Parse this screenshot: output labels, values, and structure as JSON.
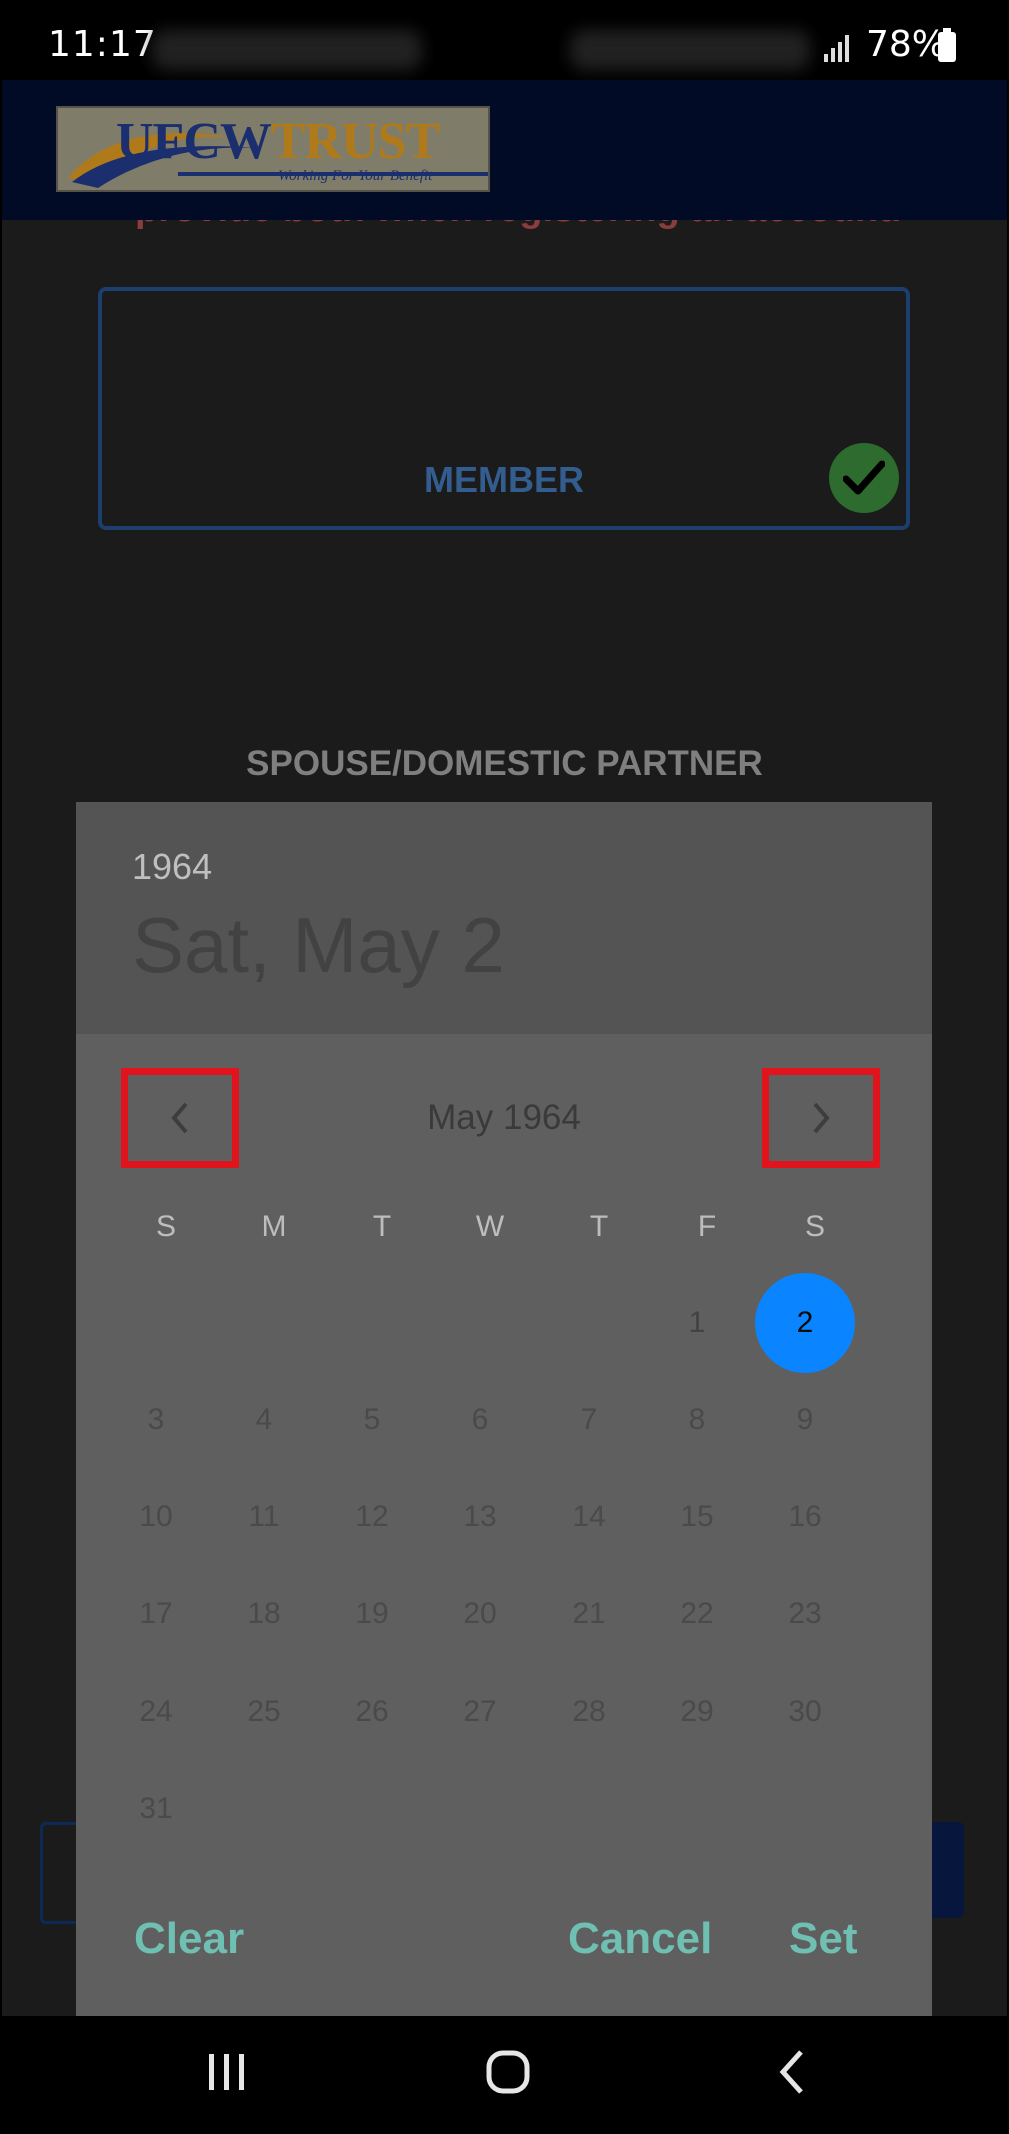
{
  "status_bar": {
    "time": "11:17",
    "battery": "78%"
  },
  "header": {
    "logo_word1": "UFCW",
    "logo_word2": "TRUST",
    "logo_tagline": "Working For Your Benefit"
  },
  "page": {
    "partial_text": "provide both when registering an account.",
    "member_label": "MEMBER",
    "spouse_label": "SPOUSE/DOMESTIC PARTNER"
  },
  "date_picker": {
    "year": "1964",
    "selected_date": "Sat, May 2",
    "month_label": "May 1964",
    "weekdays": [
      "S",
      "M",
      "T",
      "W",
      "T",
      "F",
      "S"
    ],
    "days": [
      "1",
      "2",
      "3",
      "4",
      "5",
      "6",
      "7",
      "8",
      "9",
      "10",
      "11",
      "12",
      "13",
      "14",
      "15",
      "16",
      "17",
      "18",
      "19",
      "20",
      "21",
      "22",
      "23",
      "24",
      "25",
      "26",
      "27",
      "28",
      "29",
      "30",
      "31"
    ],
    "selected_day": "2",
    "actions": {
      "clear": "Clear",
      "cancel": "Cancel",
      "set": "Set"
    },
    "accent_color": "#0a84ff",
    "highlight_color": "#e1141d"
  },
  "icons": {
    "prev": "chevron-left-icon",
    "next": "chevron-right-icon",
    "check": "check-icon",
    "nav_recents": "recents-icon",
    "nav_home": "home-icon",
    "nav_back": "back-icon"
  }
}
